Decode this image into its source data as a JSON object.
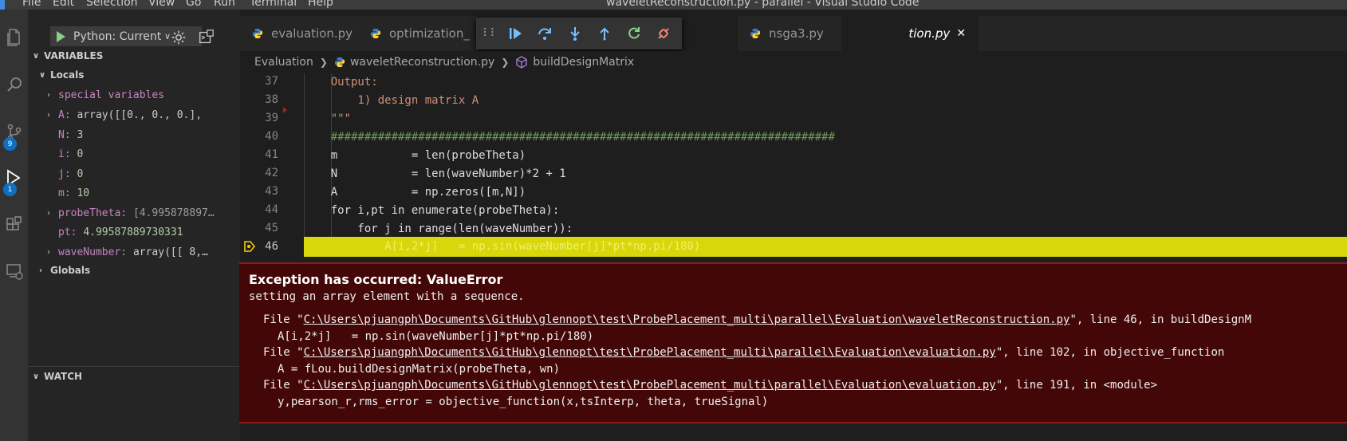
{
  "window": {
    "title": "waveletReconstruction.py - parallel - Visual Studio Code",
    "menu": [
      "File",
      "Edit",
      "Selection",
      "View",
      "Go",
      "Run",
      "Terminal",
      "Help"
    ]
  },
  "activity_bar": {
    "items": [
      {
        "icon": "files-icon"
      },
      {
        "icon": "search-icon"
      },
      {
        "icon": "source-control-icon",
        "badge": "9"
      },
      {
        "icon": "run-debug-icon",
        "badge": "1"
      },
      {
        "icon": "extensions-icon"
      },
      {
        "icon": "remote-explorer-icon"
      }
    ]
  },
  "sidebar": {
    "debug_config": "Python: Current",
    "variables_header": "VARIABLES",
    "locals_header": "Locals",
    "globals_header": "Globals",
    "watch_header": "WATCH",
    "locals": [
      {
        "name": "special variables",
        "value": "",
        "expandable": true
      },
      {
        "name": "A",
        "value": "array([[0., 0., 0.],",
        "expandable": true
      },
      {
        "name": "N",
        "value": "3",
        "expandable": false
      },
      {
        "name": "i",
        "value": "0",
        "expandable": false
      },
      {
        "name": "j",
        "value": "0",
        "expandable": false
      },
      {
        "name": "m",
        "value": "10",
        "expandable": false
      },
      {
        "name": "probeTheta",
        "value": "[4.995878897…",
        "expandable": true
      },
      {
        "name": "pt",
        "value": "4.99587889730331",
        "expandable": false
      },
      {
        "name": "waveNumber",
        "value": "array([[  8,…",
        "expandable": true
      }
    ]
  },
  "tabs": [
    {
      "label": "evaluation.py",
      "active": false
    },
    {
      "label": "optimization_",
      "active": false
    },
    {
      "label": "tion.py",
      "active": true
    },
    {
      "label": "nsga3.py",
      "active": false
    }
  ],
  "breadcrumb": {
    "folder": "Evaluation",
    "file": "waveletReconstruction.py",
    "symbol": "buildDesignMatrix"
  },
  "code": {
    "lines": [
      {
        "n": "37",
        "text": "    Output:",
        "kind": "str"
      },
      {
        "n": "38",
        "text": "        1) design matrix A",
        "kind": "str"
      },
      {
        "n": "39",
        "text": "    \"\"\"",
        "kind": "str"
      },
      {
        "n": "40",
        "text": "    ###########################################################################",
        "kind": "cmt"
      },
      {
        "n": "41",
        "text": "    m           = len(probeTheta)",
        "kind": "var"
      },
      {
        "n": "42",
        "text": "    N           = len(waveNumber)*2 + 1",
        "kind": "var"
      },
      {
        "n": "43",
        "text": "    A           = np.zeros([m,N])",
        "kind": "var"
      },
      {
        "n": "44",
        "text": "    for i,pt in enumerate(probeTheta):",
        "kind": "var"
      },
      {
        "n": "45",
        "text": "        for j in range(len(waveNumber)):",
        "kind": "var"
      }
    ],
    "current_line": {
      "n": "46",
      "text": "            A[i,2*j]   = np.sin(waveNumber[j]*pt*np.pi/180)"
    }
  },
  "exception": {
    "title": "Exception has occurred: ValueError",
    "message": "setting an array element with a sequence.",
    "traceback": [
      {
        "prefix": "File \"",
        "path": "C:\\Users\\pjuangph\\Documents\\GitHub\\glennopt\\test\\ProbePlacement_multi\\parallel\\Evaluation\\waveletReconstruction.py",
        "suffix": "\", line 46, in buildDesignM",
        "source": "A[i,2*j]   = np.sin(waveNumber[j]*pt*np.pi/180)"
      },
      {
        "prefix": "File \"",
        "path": "C:\\Users\\pjuangph\\Documents\\GitHub\\glennopt\\test\\ProbePlacement_multi\\parallel\\Evaluation\\evaluation.py",
        "suffix": "\", line 102, in objective_function",
        "source": "A = fLou.buildDesignMatrix(probeTheta, wn)"
      },
      {
        "prefix": "File \"",
        "path": "C:\\Users\\pjuangph\\Documents\\GitHub\\glennopt\\test\\ProbePlacement_multi\\parallel\\Evaluation\\evaluation.py",
        "suffix": "\", line 191, in <module>",
        "source": "y,pearson_r,rms_error = objective_function(x,tsInterp, theta, trueSignal)"
      }
    ]
  },
  "colors": {
    "accent": "#0e70c0",
    "current_line": "#d7d70c",
    "exception_bg": "#440707",
    "exception_border": "#8b1c1c"
  }
}
